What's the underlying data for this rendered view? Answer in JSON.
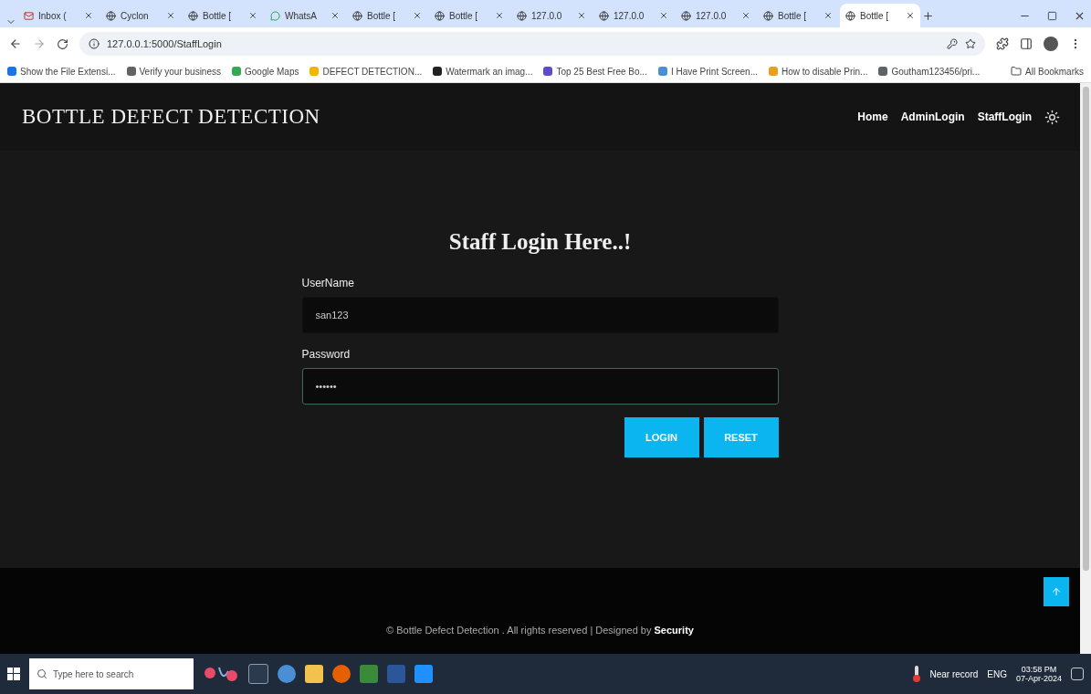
{
  "browser": {
    "tabs": [
      {
        "label": "Inbox (",
        "kind": "mail",
        "selected": false
      },
      {
        "label": "Cyclon",
        "kind": "web",
        "selected": false
      },
      {
        "label": "Bottle [",
        "kind": "web",
        "selected": false
      },
      {
        "label": "WhatsA",
        "kind": "chat",
        "selected": false
      },
      {
        "label": "Bottle [",
        "kind": "web",
        "selected": false
      },
      {
        "label": "Bottle [",
        "kind": "web",
        "selected": false
      },
      {
        "label": "127.0.0",
        "kind": "web",
        "selected": false
      },
      {
        "label": "127.0.0",
        "kind": "web",
        "selected": false
      },
      {
        "label": "127.0.0",
        "kind": "web",
        "selected": false
      },
      {
        "label": "Bottle [",
        "kind": "web",
        "selected": false
      },
      {
        "label": "Bottle [",
        "kind": "web",
        "selected": true
      }
    ],
    "address": "127.0.0.1:5000/StaffLogin",
    "bookmarks": [
      {
        "label": "Show the File Extensi...",
        "color": "#1a73e8"
      },
      {
        "label": "Verify your business",
        "color": "#5f6368"
      },
      {
        "label": "Google Maps",
        "color": "#34a853"
      },
      {
        "label": "DEFECT DETECTION...",
        "color": "#f4b400"
      },
      {
        "label": "Watermark an imag...",
        "color": "#202124"
      },
      {
        "label": "Top 25 Best Free Bo...",
        "color": "#5c4bc6"
      },
      {
        "label": "I Have Print Screen...",
        "color": "#4a8fd6"
      },
      {
        "label": "How to disable Prin...",
        "color": "#e8a020"
      },
      {
        "label": "Goutham123456/pri...",
        "color": "#5f6368"
      }
    ],
    "all_bookmarks": "All Bookmarks"
  },
  "site": {
    "brand": "BOTTLE DEFECT DETECTION",
    "nav": [
      {
        "label": "Home"
      },
      {
        "label": "AdminLogin"
      },
      {
        "label": "StaffLogin"
      }
    ],
    "heading": "Staff Login Here..!",
    "fields": [
      {
        "label": "UserName",
        "value": "san123",
        "focused": false
      },
      {
        "label": "Password",
        "value": "••••••",
        "focused": true
      }
    ],
    "buttons": [
      "LOGIN",
      "RESET"
    ],
    "footer": "© Bottle Defect Detection . All rights reserved | Designed by **Security**"
  },
  "taskbar": {
    "search_placeholder": "Type here to search",
    "weather": "Near record",
    "language": "ENG",
    "time": "03:58 PM",
    "date": "07-Apr-2024"
  }
}
